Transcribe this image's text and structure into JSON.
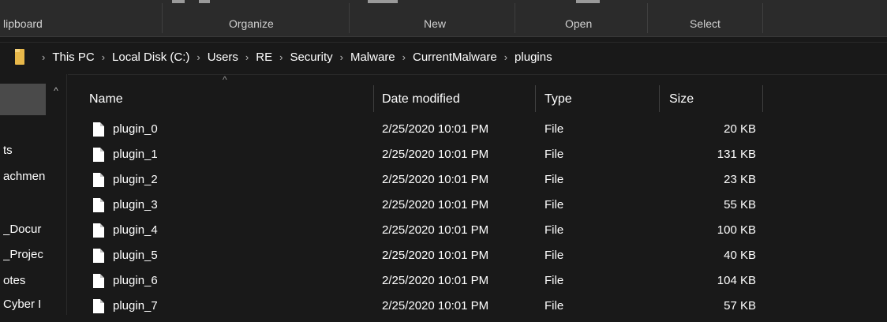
{
  "ribbon": {
    "groups": [
      "lipboard",
      "Organize",
      "New",
      "Open",
      "Select"
    ]
  },
  "address_bar": {
    "crumbs": [
      "This PC",
      "Local Disk (C:)",
      "Users",
      "RE",
      "Security",
      "Malware",
      "CurrentMalware",
      "plugins"
    ]
  },
  "nav_pane": {
    "items": [
      "ts",
      "achmen",
      "_Docur",
      "_Projec",
      "otes",
      "Cyber I"
    ]
  },
  "columns": {
    "name": "Name",
    "date": "Date modified",
    "type": "Type",
    "size": "Size"
  },
  "files": [
    {
      "name": "plugin_0",
      "date": "2/25/2020 10:01 PM",
      "type": "File",
      "size": "20 KB"
    },
    {
      "name": "plugin_1",
      "date": "2/25/2020 10:01 PM",
      "type": "File",
      "size": "131 KB"
    },
    {
      "name": "plugin_2",
      "date": "2/25/2020 10:01 PM",
      "type": "File",
      "size": "23 KB"
    },
    {
      "name": "plugin_3",
      "date": "2/25/2020 10:01 PM",
      "type": "File",
      "size": "55 KB"
    },
    {
      "name": "plugin_4",
      "date": "2/25/2020 10:01 PM",
      "type": "File",
      "size": "100 KB"
    },
    {
      "name": "plugin_5",
      "date": "2/25/2020 10:01 PM",
      "type": "File",
      "size": "40 KB"
    },
    {
      "name": "plugin_6",
      "date": "2/25/2020 10:01 PM",
      "type": "File",
      "size": "104 KB"
    },
    {
      "name": "plugin_7",
      "date": "2/25/2020 10:01 PM",
      "type": "File",
      "size": "57 KB"
    }
  ],
  "icons": {
    "folder": "folder-icon",
    "file": "file-icon",
    "breadcrumb_separator": "chevron-right-icon",
    "sort": "sort-up-icon",
    "scroll_up": "scroll-up-icon"
  },
  "colors": {
    "background": "#191919",
    "ribbon": "#2b2b2b",
    "text": "#ffffff",
    "folder": "#e8b84a"
  }
}
